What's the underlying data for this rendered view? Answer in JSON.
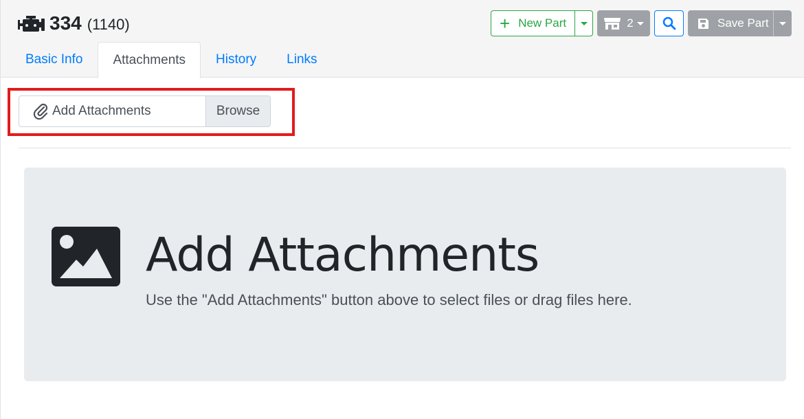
{
  "header": {
    "icon": "engine-icon",
    "part_number": "334",
    "part_id": "(1140)"
  },
  "toolbar": {
    "new_part_label": "New Part",
    "store_count": "2",
    "save_part_label": "Save Part"
  },
  "tabs": [
    {
      "label": "Basic Info",
      "active": false
    },
    {
      "label": "Attachments",
      "active": true
    },
    {
      "label": "History",
      "active": false
    },
    {
      "label": "Links",
      "active": false
    }
  ],
  "attachments": {
    "input_label": "Add Attachments",
    "browse_label": "Browse",
    "dropzone_title": "Add Attachments",
    "dropzone_text": "Use the \"Add Attachments\" button above to select files or drag files here."
  },
  "colors": {
    "primary": "#007bff",
    "success": "#28a745",
    "secondary": "#9ea2a6",
    "highlight": "#e21b1b"
  }
}
